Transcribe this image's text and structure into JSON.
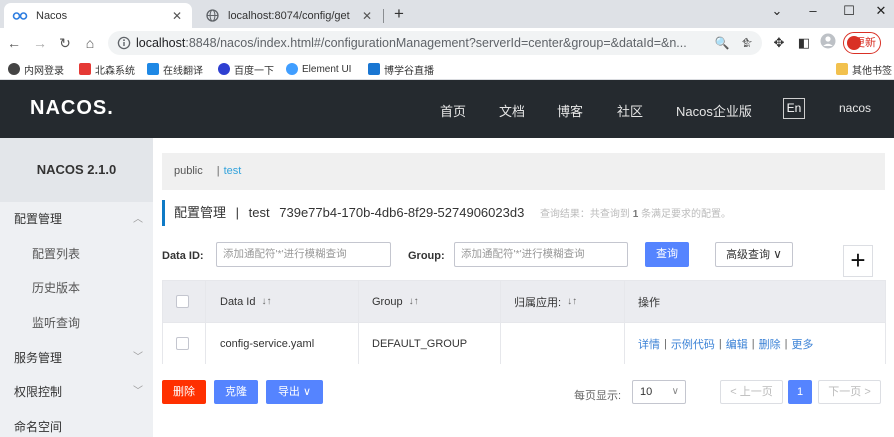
{
  "browser": {
    "tabs": [
      {
        "title": "Nacos",
        "active": true
      },
      {
        "title": "localhost:8074/config/get",
        "active": false
      }
    ],
    "url_host": "localhost",
    "url_rest": ":8848/nacos/index.html#/configurationManagement?serverId=center&group=&dataId=&n...",
    "update_label": "更新",
    "bookmarks": [
      "内网登录",
      "北森系统",
      "在线翻译",
      "百度一下",
      "Element UI",
      "博学谷直播"
    ],
    "other_bookmarks": "其他书签"
  },
  "header": {
    "logo": "NACOS.",
    "nav": [
      "首页",
      "文档",
      "博客",
      "社区",
      "Nacos企业版"
    ],
    "lang": "En",
    "user": "nacos"
  },
  "sidebar": {
    "version": "NACOS 2.1.0",
    "items": [
      {
        "label": "配置管理",
        "type": "group",
        "arrow": "up"
      },
      {
        "label": "配置列表",
        "type": "sub"
      },
      {
        "label": "历史版本",
        "type": "sub"
      },
      {
        "label": "监听查询",
        "type": "sub"
      },
      {
        "label": "服务管理",
        "type": "group",
        "arrow": "down"
      },
      {
        "label": "权限控制",
        "type": "group",
        "arrow": "down"
      },
      {
        "label": "命名空间",
        "type": "group"
      }
    ]
  },
  "namespace": {
    "public": "public",
    "sep": "|",
    "current": "test"
  },
  "page": {
    "title": "配置管理",
    "sep": "|",
    "ns_name": "test",
    "ns_id": "739e77b4-170b-4db6-8f29-5274906023d3",
    "hint_prefix": "查询结果：共查询到",
    "hint_count": "1",
    "hint_suffix": "条满足要求的配置。"
  },
  "filters": {
    "dataid_label": "Data ID:",
    "dataid_placeholder": "添加通配符'*'进行模糊查询",
    "group_label": "Group:",
    "group_placeholder": "添加通配符'*'进行模糊查询",
    "query_label": "查询",
    "advanced_label": "高级查询"
  },
  "table": {
    "columns": [
      "Data Id",
      "Group",
      "归属应用:",
      "操作"
    ],
    "rows": [
      {
        "data_id": "config-service.yaml",
        "group": "DEFAULT_GROUP",
        "app": "",
        "actions": [
          "详情",
          "示例代码",
          "编辑",
          "删除",
          "更多"
        ]
      }
    ]
  },
  "footer": {
    "delete_label": "删除",
    "clone_label": "克隆",
    "export_label": "导出",
    "page_size_label": "每页显示:",
    "page_size": "10",
    "prev_label": "上一页",
    "current_page": "1",
    "next_label": "下一页"
  },
  "colors": {
    "header_bg": "#252a2f",
    "primary": "#5584ff",
    "danger": "#ff3000",
    "link": "#3b82d6",
    "accent_border": "#0f7ac6"
  }
}
